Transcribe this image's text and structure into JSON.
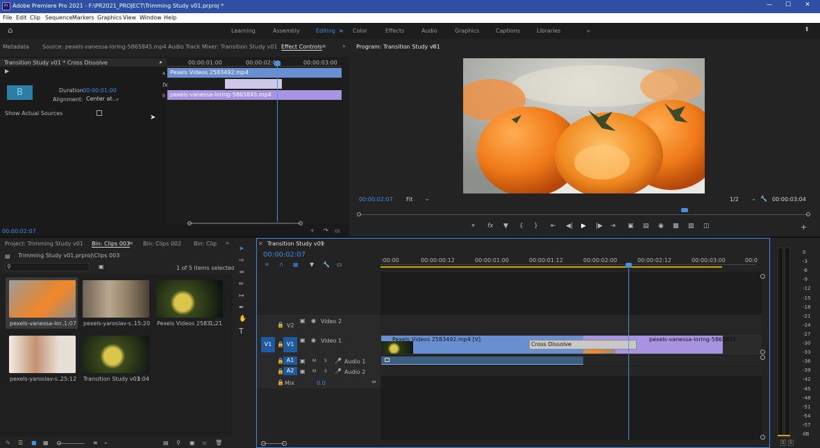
{
  "window": {
    "title": "Adobe Premiere Pro 2021 - F:\\PR2021_PROJECT\\Trimming Study v01.prproj *",
    "app_icon": "Pr"
  },
  "menu": [
    "File",
    "Edit",
    "Clip",
    "Sequence",
    "Markers",
    "Graphics",
    "View",
    "Window",
    "Help"
  ],
  "workspaces": {
    "learning": "Learning",
    "assembly": "Assembly",
    "editing": "Editing",
    "color": "Color",
    "effects": "Effects",
    "audio": "Audio",
    "graphics": "Graphics",
    "captions": "Captions",
    "libraries": "Libraries",
    "more": "»"
  },
  "source_tabs": {
    "metadata": "Metadata",
    "source": "Source: pexels-vanessa-loring-5865845.mp4",
    "mixer": "Audio Track Mixer: Transition Study v01",
    "effect_controls": "Effect Controls",
    "more": "»"
  },
  "effect_controls": {
    "header": "Transition Study v01 * Cross Dissolve",
    "thumb_letter": "B",
    "duration_label": "Duration",
    "duration_value": "00:00:01:00",
    "alignment_label": "Alignment:",
    "alignment_value": "Center at...",
    "show_actual": "Show Actual Sources",
    "ruler": [
      "00:00:01:00",
      "00:00:02:00",
      "00:00:03:00"
    ],
    "track_a_label": "A",
    "track_b_label": "B",
    "fx_label": "fx",
    "clip_a": "Pexels Videos 2583492.mp4",
    "clip_b": "pexels-vanessa-loring-5865845.mp4",
    "timecode": "00:00:02:07"
  },
  "program": {
    "title": "Program: Transition Study v01",
    "timecode": "00:00:02:07",
    "fit": "Fit",
    "resolution": "1/2",
    "duration": "00:00:03:04"
  },
  "project_tabs": {
    "project": "Project: Trimming Study v01",
    "bin003": "Bin: Clips 003",
    "bin002": "Bin: Clips 002",
    "bin": "Bin: Clip",
    "more": "»"
  },
  "project": {
    "path": "Trimming Study v01.prproj\\Clips 003",
    "selection": "1 of 5 items selected",
    "items": [
      {
        "name": "pexels-vanessa-lor...",
        "duration": "1:07"
      },
      {
        "name": "pexels-yaroslav-s...",
        "duration": "15:20"
      },
      {
        "name": "Pexels Videos 2583...",
        "duration": "1:21"
      },
      {
        "name": "pexels-yaroslav-s...",
        "duration": "25:12"
      },
      {
        "name": "Transition Study v01",
        "duration": "3:04"
      }
    ]
  },
  "timeline": {
    "title": "Transition Study v01",
    "timecode": "00:00:02:07",
    "ruler": [
      ":00:00",
      "00:00:00:12",
      "00:00:01:00",
      "00:00:01:12",
      "00:00:02:00",
      "00:00:02:12",
      "00:00:03:00",
      "00:0"
    ],
    "tracks": {
      "v2": "V2",
      "v2_name": "Video 2",
      "v1_src": "V1",
      "v1": "V1",
      "v1_name": "Video 1",
      "a1": "A1",
      "a1_name": "Audio 1",
      "a2": "A2",
      "a2_name": "Audio 2",
      "mix": "Mix",
      "mix_value": "0.0",
      "m": "M",
      "s": "S"
    },
    "clip_v1a": "Pexels Videos 2583492.mp4 [V]",
    "transition": "Cross Dissolve",
    "clip_v1b": "pexels-vanessa-loring-5865845."
  },
  "meter": {
    "scale": [
      "0",
      "-3",
      "-6",
      "-9",
      "-12",
      "-15",
      "-18",
      "-21",
      "-24",
      "-27",
      "-30",
      "-33",
      "-36",
      "-39",
      "-42",
      "-45",
      "-48",
      "-51",
      "-54",
      "-57",
      "dB"
    ],
    "s1": "S",
    "s2": "S"
  },
  "colors": {
    "accent": "#3d8ee6",
    "clip_video": "#6a8fd0",
    "clip_purple": "#a894e0",
    "titlebar": "#2e4fa3",
    "playhead": "#4b8fe0"
  }
}
